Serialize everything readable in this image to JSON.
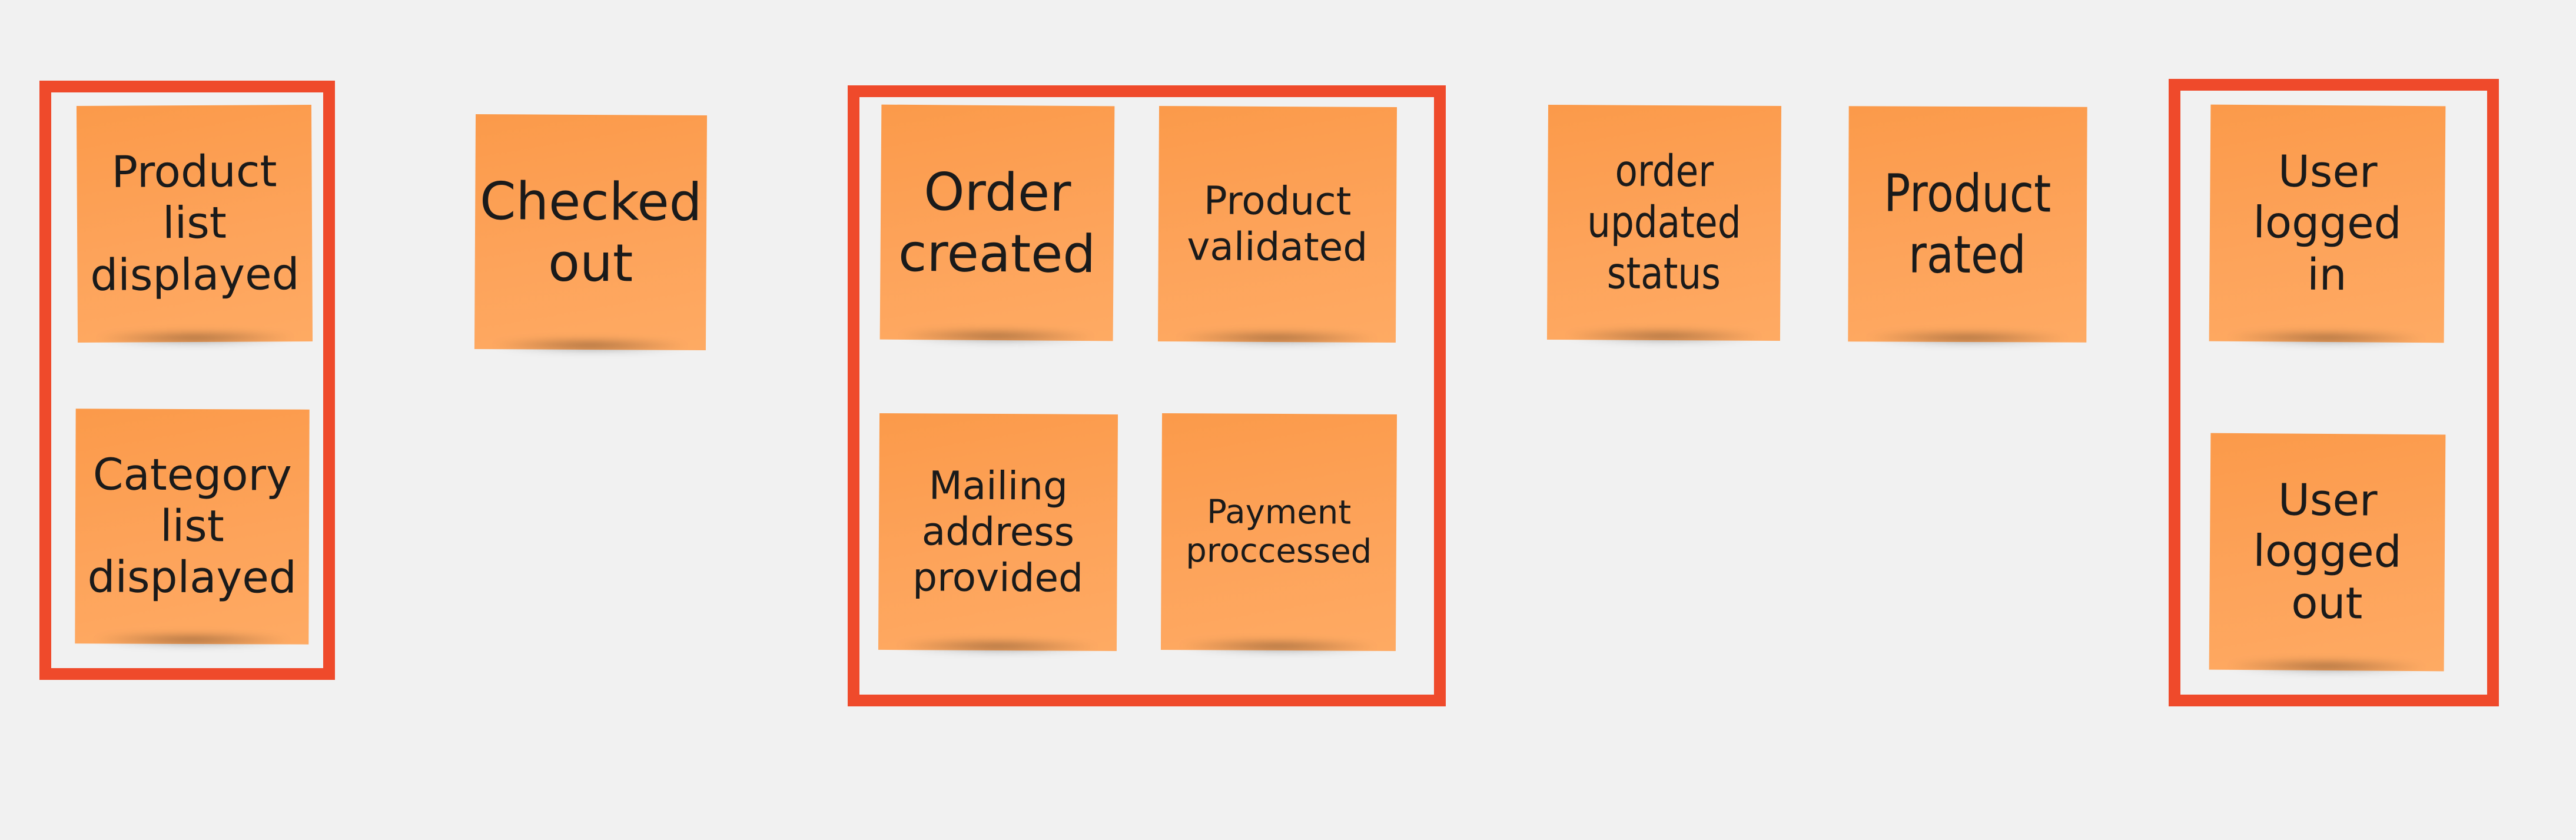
{
  "board": {
    "background_color": "#f1f1f1",
    "sticky_color": "#fd9f52",
    "frame_color": "#ef4a2b"
  },
  "groups": [
    {
      "name": "catalog-group",
      "notes": [
        {
          "text": "Product\nlist\ndisplayed"
        },
        {
          "text": "Category\nlist\ndisplayed"
        }
      ]
    },
    {
      "name": "order-group",
      "notes": [
        {
          "text": "Order\ncreated"
        },
        {
          "text": "Product\nvalidated"
        },
        {
          "text": "Mailing\naddress\nprovided"
        },
        {
          "text": "Payment\nproccessed"
        }
      ]
    },
    {
      "name": "user-group",
      "notes": [
        {
          "text": "User\nlogged\nin"
        },
        {
          "text": "User\nlogged\nout"
        }
      ]
    }
  ],
  "standalone_notes": [
    {
      "text": "Checked\nout"
    },
    {
      "text": "order\nupdated\nstatus"
    },
    {
      "text": "Product\nrated"
    }
  ]
}
